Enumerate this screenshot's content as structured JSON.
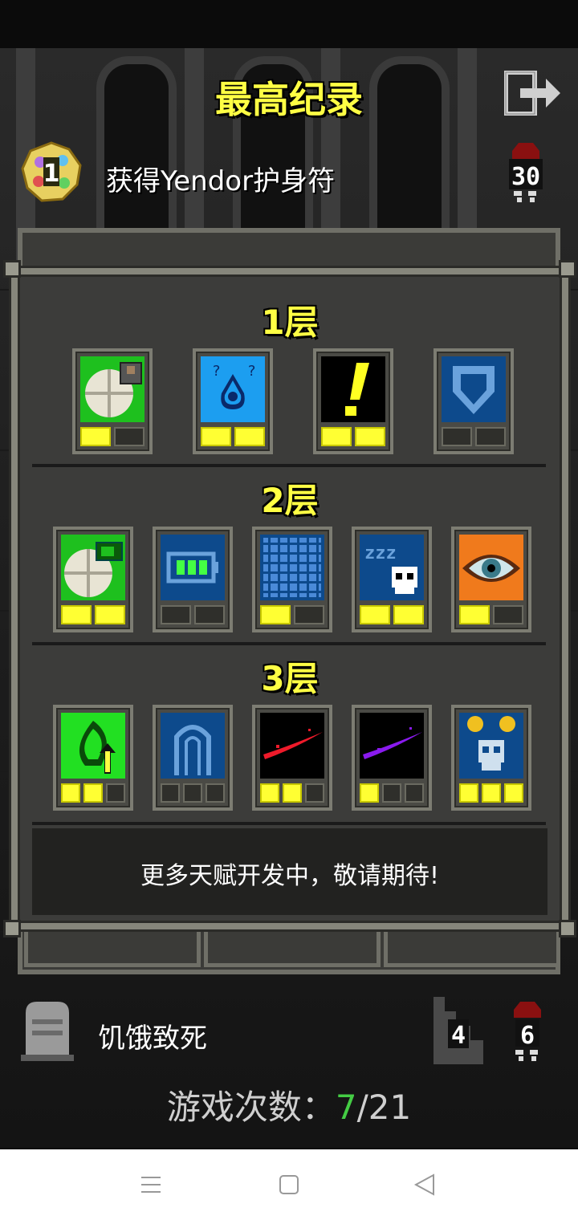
{
  "header": {
    "title": "最高纪录"
  },
  "record": {
    "rank": "1",
    "description": "获得Yendor护身符",
    "score": "30"
  },
  "talents": {
    "tiers": [
      {
        "label": "1层",
        "items": [
          {
            "icon": "cooked-food-icon",
            "filled": 1,
            "max": 2
          },
          {
            "icon": "water-drop-icon",
            "filled": 2,
            "max": 2
          },
          {
            "icon": "exclamation-icon",
            "filled": 2,
            "max": 2
          },
          {
            "icon": "shield-icon",
            "filled": 0,
            "max": 2
          }
        ]
      },
      {
        "label": "2层",
        "items": [
          {
            "icon": "food-battery-icon",
            "filled": 2,
            "max": 2
          },
          {
            "icon": "battery-icon",
            "filled": 0,
            "max": 2
          },
          {
            "icon": "grid-icon",
            "filled": 1,
            "max": 2
          },
          {
            "icon": "sleep-skull-icon",
            "filled": 2,
            "max": 2
          },
          {
            "icon": "eye-icon",
            "filled": 1,
            "max": 2
          }
        ]
      },
      {
        "label": "3层",
        "items": [
          {
            "icon": "leaf-arrow-icon",
            "filled": 2,
            "max": 3
          },
          {
            "icon": "arch-icon",
            "filled": 0,
            "max": 3
          },
          {
            "icon": "red-slash-icon",
            "filled": 2,
            "max": 3
          },
          {
            "icon": "purple-slash-icon",
            "filled": 1,
            "max": 3
          },
          {
            "icon": "gold-skull-icon",
            "filled": 3,
            "max": 3
          }
        ]
      }
    ],
    "footer": "更多天赋开发中，敬请期待!"
  },
  "death": {
    "cause": "饥饿致死",
    "depth": "4",
    "level": "6"
  },
  "games": {
    "label": "游戏次数：",
    "current": "7",
    "separator": "/",
    "total": "21"
  },
  "colors": {
    "accent_yellow": "#ffff44",
    "current_games_green": "#44cc44"
  }
}
